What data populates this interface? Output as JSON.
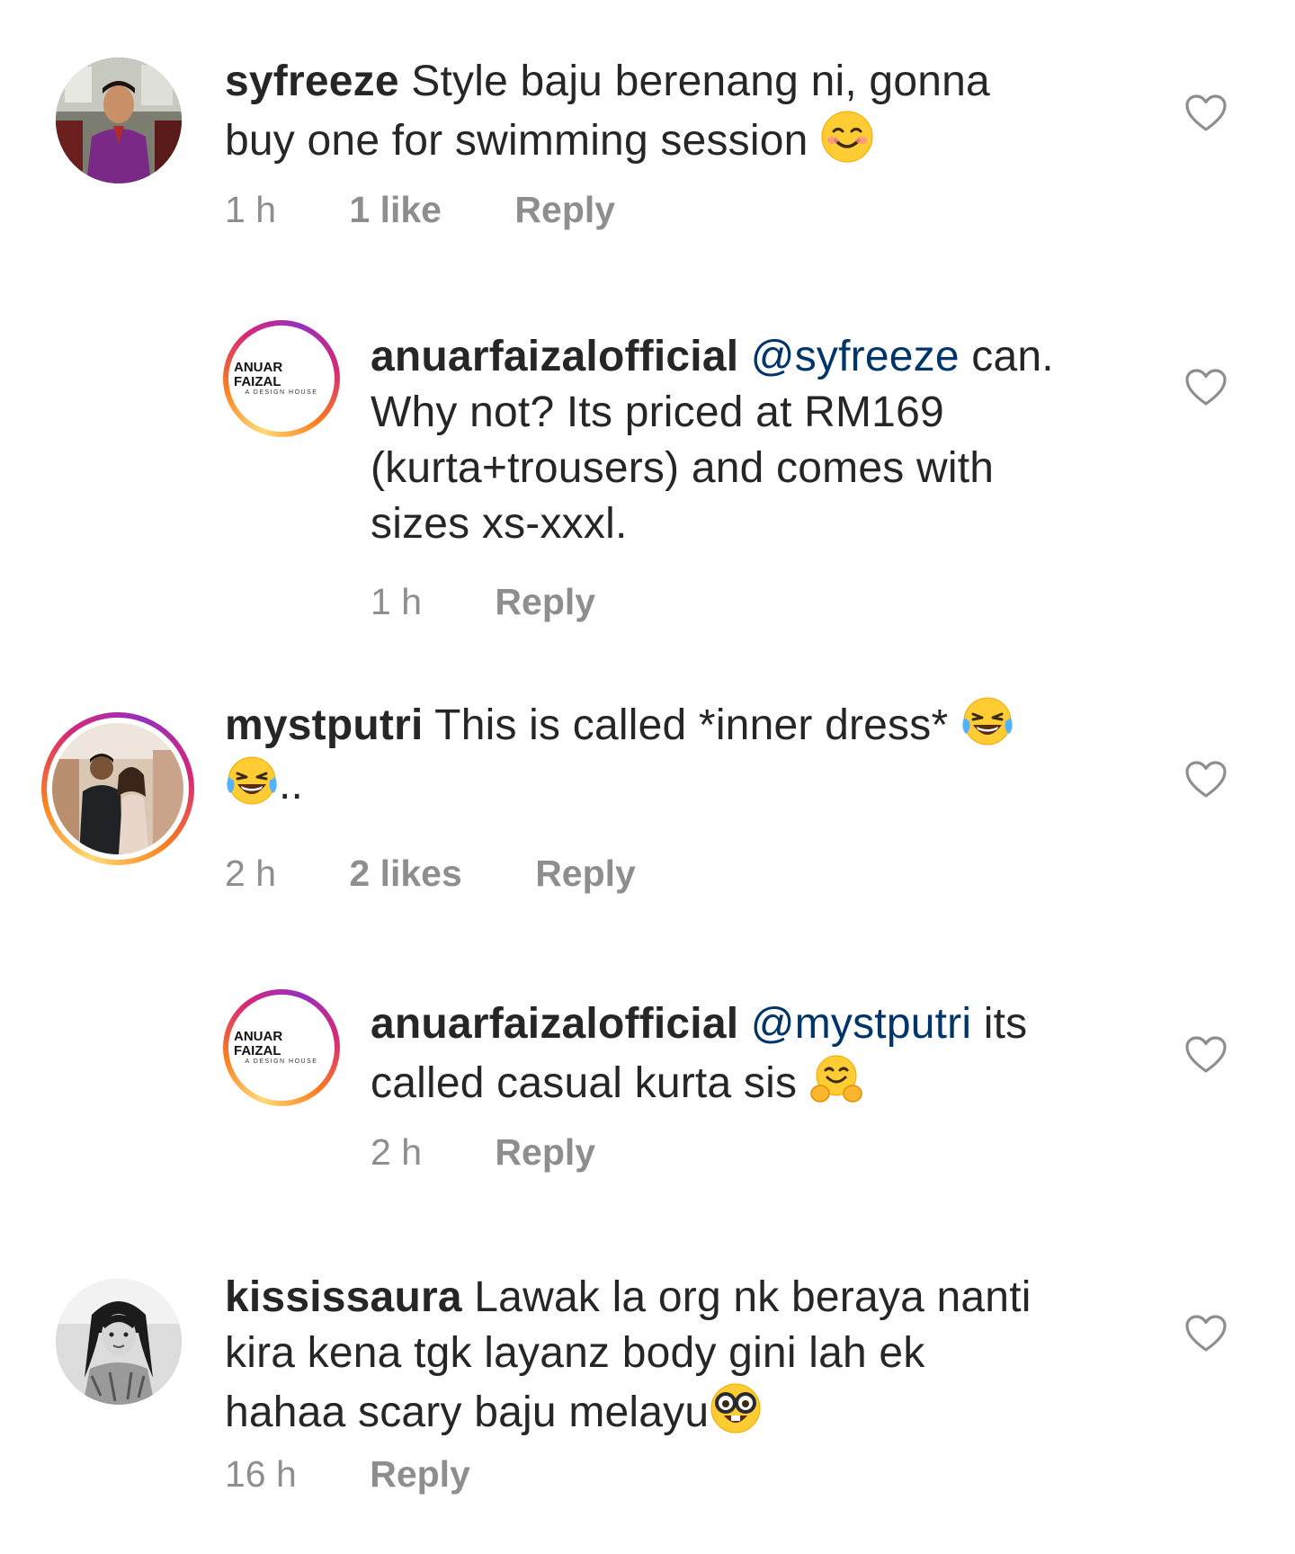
{
  "comments": [
    {
      "username": "syfreeze",
      "text_line1": " Style baju berenang ni, gonna",
      "text_line2": "buy one for swimming session ",
      "emoji": "smiling-face-emoji",
      "time": "1 h",
      "likes": "1 like",
      "reply": "Reply",
      "avatar": "profile-photo-man-purple-shirt"
    },
    {
      "username": "anuarfaizalofficial",
      "mention": "@syfreeze",
      "text_line1_tail": " can.",
      "text_line2": "Why not? Its priced at RM169",
      "text_line3": "(kurta+trousers) and comes with",
      "text_line4": "sizes xs-xxxl.",
      "time": "1 h",
      "reply": "Reply",
      "avatar_brand": "ANUAR FAIZAL",
      "avatar_brand_sub": "A DESIGN HOUSE"
    },
    {
      "username": "mystputri",
      "text_line1": " This is called *inner dress* ",
      "text_line2_tail": "..",
      "emoji": "tears-of-joy-emoji",
      "time": "2 h",
      "likes": "2 likes",
      "reply": "Reply",
      "avatar": "profile-photo-couple"
    },
    {
      "username": "anuarfaizalofficial",
      "mention": "@mystputri",
      "text_line1_tail": " its",
      "text_line2": "called casual kurta sis ",
      "emoji": "hugging-face-emoji",
      "time": "2 h",
      "reply": "Reply",
      "avatar_brand": "ANUAR FAIZAL",
      "avatar_brand_sub": "A DESIGN HOUSE"
    },
    {
      "username": "kississaura",
      "text_line1": " Lawak la org nk beraya nanti",
      "text_line2": "kira kena tgk layanz body gini lah ek",
      "text_line3": "hahaa scary baju melayu",
      "emoji": "nerd-face-emoji",
      "time": "16 h",
      "reply": "Reply",
      "avatar": "profile-photo-woman-grayscale"
    }
  ],
  "colors": {
    "text": "#262626",
    "meta": "#8e8e8e",
    "mention": "#003569",
    "heart_outline": "#8e8e8e"
  },
  "icons": {
    "like": "heart-outline-icon"
  }
}
